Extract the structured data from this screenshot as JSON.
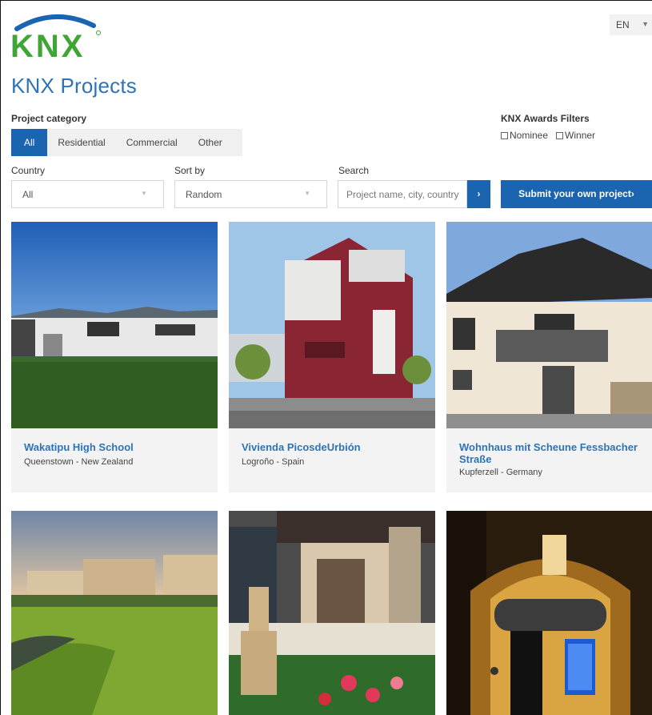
{
  "header": {
    "logo_text": "KNX",
    "language": "EN",
    "page_title": "KNX Projects"
  },
  "filters": {
    "category_label": "Project category",
    "categories": [
      {
        "label": "All",
        "active": true
      },
      {
        "label": "Residential",
        "active": false
      },
      {
        "label": "Commercial",
        "active": false
      },
      {
        "label": "Other",
        "active": false
      }
    ],
    "awards_label": "KNX Awards Filters",
    "awards": [
      {
        "label": "Nominee",
        "checked": false
      },
      {
        "label": "Winner",
        "checked": false
      }
    ],
    "country_label": "Country",
    "country_value": "All",
    "sort_label": "Sort by",
    "sort_value": "Random",
    "search_label": "Search",
    "search_placeholder": "Project name, city, country",
    "search_button": "›",
    "submit_button": "Submit your own project›"
  },
  "projects": [
    {
      "title": "Wakatipu High School",
      "location": "Queenstown - New Zealand"
    },
    {
      "title": "Vivienda PicosdeUrbión",
      "location": "Logroño - Spain"
    },
    {
      "title": "Wohnhaus mit Scheune Fessbacher Straße",
      "location": "Kupferzell - Germany"
    }
  ],
  "colors": {
    "brand_blue": "#1a64b0",
    "title_blue": "#2d73b5",
    "logo_green": "#3fa535"
  }
}
